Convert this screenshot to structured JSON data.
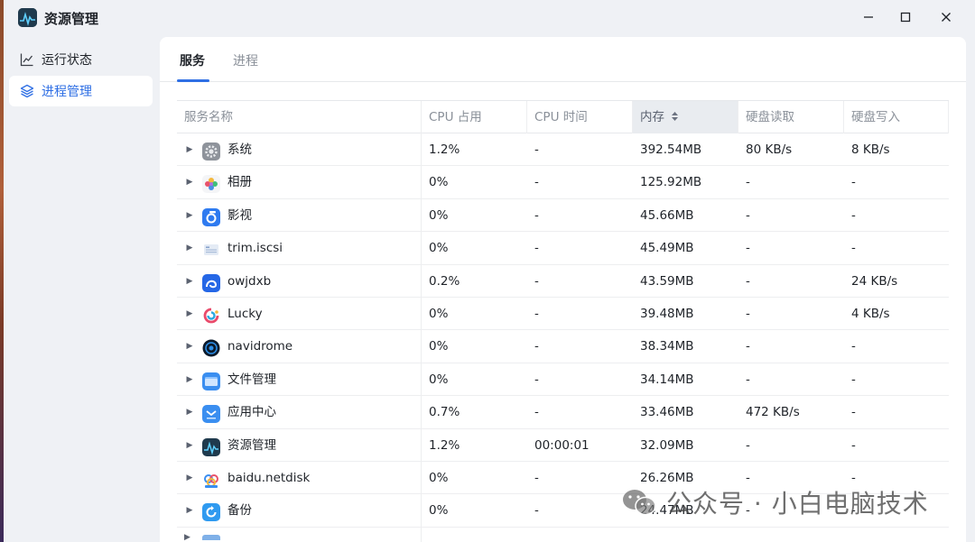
{
  "window": {
    "title": "资源管理"
  },
  "sidebar": {
    "items": [
      {
        "label": "运行状态",
        "icon": "chart-line-icon",
        "active": false
      },
      {
        "label": "进程管理",
        "icon": "layers-icon",
        "active": true
      }
    ]
  },
  "tabs": [
    {
      "label": "服务",
      "active": true
    },
    {
      "label": "进程",
      "active": false
    }
  ],
  "table": {
    "columns": [
      "服务名称",
      "CPU 占用",
      "CPU 时间",
      "内存",
      "硬盘读取",
      "硬盘写入"
    ],
    "sorted_column": "内存",
    "rows": [
      {
        "name": "系统",
        "icon": "settings-gear-icon",
        "cpu": "1.2%",
        "cpu_time": "-",
        "memory": "392.54MB",
        "disk_read": "80 KB/s",
        "disk_write": "8 KB/s"
      },
      {
        "name": "相册",
        "icon": "photos-flower-icon",
        "cpu": "0%",
        "cpu_time": "-",
        "memory": "125.92MB",
        "disk_read": "-",
        "disk_write": "-"
      },
      {
        "name": "影视",
        "icon": "video-player-icon",
        "cpu": "0%",
        "cpu_time": "-",
        "memory": "45.66MB",
        "disk_read": "-",
        "disk_write": "-"
      },
      {
        "name": "trim.iscsi",
        "icon": "iscsi-doc-icon",
        "cpu": "0%",
        "cpu_time": "-",
        "memory": "45.49MB",
        "disk_read": "-",
        "disk_write": "-"
      },
      {
        "name": "owjdxb",
        "icon": "owjdxb-app-icon",
        "cpu": "0.2%",
        "cpu_time": "-",
        "memory": "43.59MB",
        "disk_read": "-",
        "disk_write": "24 KB/s"
      },
      {
        "name": "Lucky",
        "icon": "lucky-swirl-icon",
        "cpu": "0%",
        "cpu_time": "-",
        "memory": "39.48MB",
        "disk_read": "-",
        "disk_write": "4 KB/s"
      },
      {
        "name": "navidrome",
        "icon": "navidrome-disc-icon",
        "cpu": "0%",
        "cpu_time": "-",
        "memory": "38.34MB",
        "disk_read": "-",
        "disk_write": "-"
      },
      {
        "name": "文件管理",
        "icon": "folder-icon",
        "cpu": "0%",
        "cpu_time": "-",
        "memory": "34.14MB",
        "disk_read": "-",
        "disk_write": "-"
      },
      {
        "name": "应用中心",
        "icon": "app-store-icon",
        "cpu": "0.7%",
        "cpu_time": "-",
        "memory": "33.46MB",
        "disk_read": "472 KB/s",
        "disk_write": "-"
      },
      {
        "name": "资源管理",
        "icon": "resource-monitor-icon",
        "cpu": "1.2%",
        "cpu_time": "00:00:01",
        "memory": "32.09MB",
        "disk_read": "-",
        "disk_write": "-"
      },
      {
        "name": "baidu.netdisk",
        "icon": "baidu-netdisk-icon",
        "cpu": "0%",
        "cpu_time": "-",
        "memory": "26.26MB",
        "disk_read": "-",
        "disk_write": "-"
      },
      {
        "name": "备份",
        "icon": "backup-icon",
        "cpu": "0%",
        "cpu_time": "-",
        "memory": "24.47MB",
        "disk_read": "-",
        "disk_write": "-"
      }
    ]
  },
  "watermark": {
    "text": "公众号 · 小白电脑技术"
  },
  "colors": {
    "accent": "#2f6fe4",
    "sidebar_bg": "#eff1f5",
    "panel_bg": "#ffffff"
  }
}
